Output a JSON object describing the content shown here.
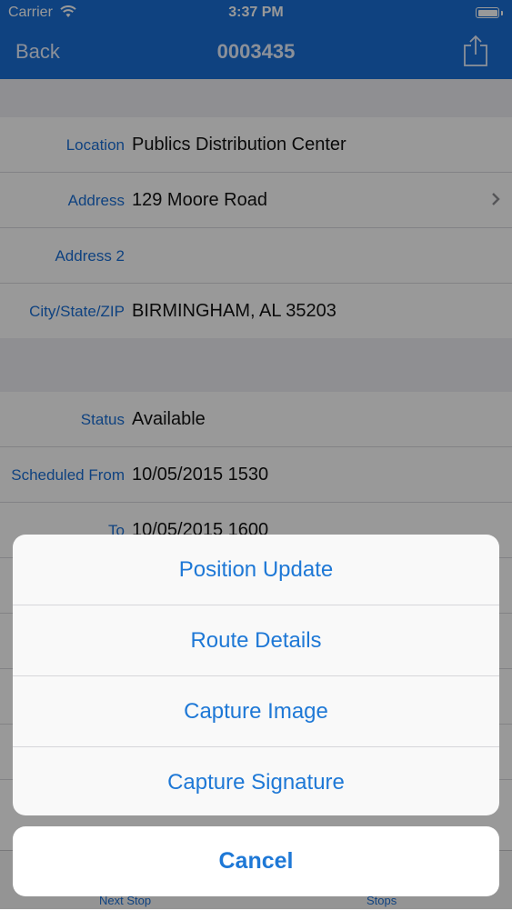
{
  "status_bar": {
    "carrier": "Carrier",
    "time": "3:37 PM"
  },
  "nav": {
    "back_label": "Back",
    "title": "0003435"
  },
  "location_section": [
    {
      "label": "Location",
      "value": "Publics Distribution Center"
    },
    {
      "label": "Address",
      "value": "129 Moore Road"
    },
    {
      "label": "Address 2",
      "value": ""
    },
    {
      "label": "City/State/ZIP",
      "value": "BIRMINGHAM, AL 35203"
    }
  ],
  "status_section": [
    {
      "label": "Status",
      "value": "Available"
    },
    {
      "label": "Scheduled From",
      "value": "10/05/2015 1530"
    },
    {
      "label": "To",
      "value": "10/05/2015 1600"
    }
  ],
  "tabbar": {
    "next_stop": "Next Stop",
    "stops": "Stops"
  },
  "action_sheet": {
    "items": [
      "Position Update",
      "Route Details",
      "Capture Image",
      "Capture Signature"
    ],
    "cancel": "Cancel"
  },
  "colors": {
    "accent": "#1a6fd6",
    "sheet_text": "#1e78d6"
  }
}
